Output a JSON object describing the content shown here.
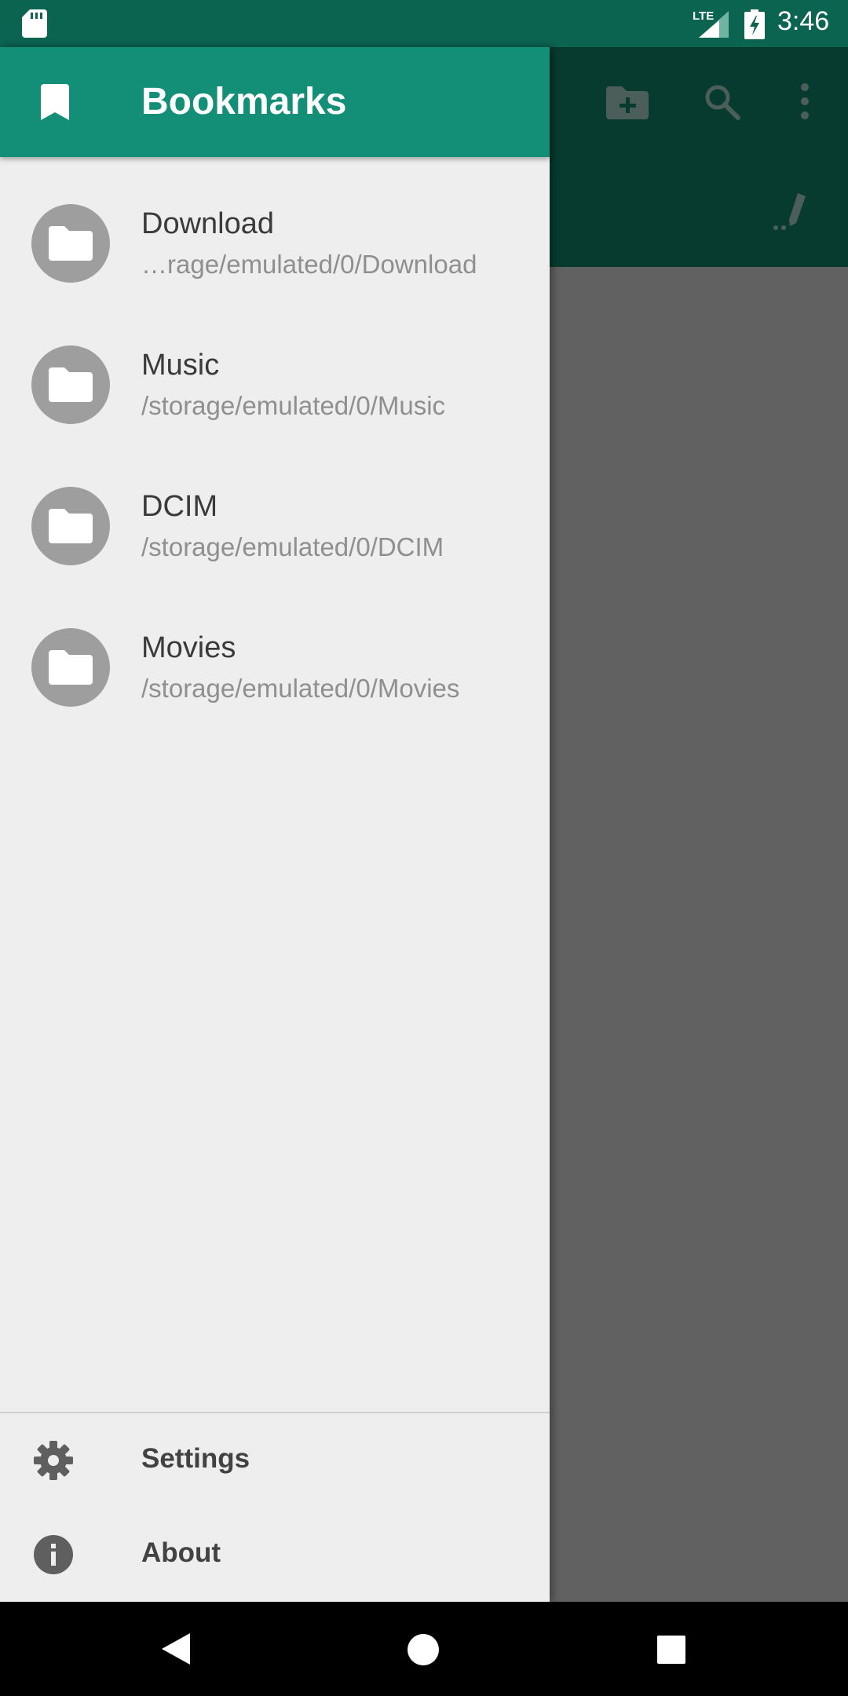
{
  "status_bar": {
    "network": "LTE",
    "time": "3:46"
  },
  "drawer": {
    "title": "Bookmarks",
    "bookmarks": [
      {
        "name": "Download",
        "path": "…rage/emulated/0/Download"
      },
      {
        "name": "Music",
        "path": "/storage/emulated/0/Music"
      },
      {
        "name": "DCIM",
        "path": "/storage/emulated/0/DCIM"
      },
      {
        "name": "Movies",
        "path": "/storage/emulated/0/Movies"
      }
    ],
    "footer": {
      "settings_label": "Settings",
      "about_label": "About"
    }
  },
  "toolbar": {
    "icons": [
      "create-folder-icon",
      "search-icon",
      "more-vert-icon",
      "edit-path-icon"
    ]
  },
  "colors": {
    "primary": "#128f76",
    "primary_dark": "#0b6450",
    "toolbar_dimmed": "#083b30",
    "drawer_bg": "#eeeeee",
    "scrim": "#616161"
  }
}
